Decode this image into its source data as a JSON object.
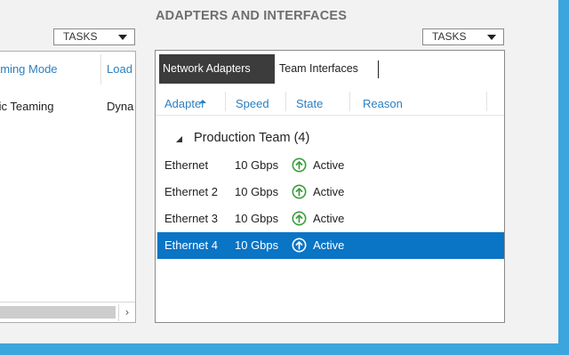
{
  "section": {
    "title": "ADAPTERS AND INTERFACES"
  },
  "left_tasks": {
    "label": "TASKS"
  },
  "right_tasks": {
    "label": "TASKS"
  },
  "left_panel": {
    "columns": [
      "aming Mode",
      "Load"
    ],
    "row": [
      "tic Teaming",
      "Dyna"
    ],
    "scroll_arrow": "›"
  },
  "tabs": [
    {
      "label": "Network Adapters",
      "active": true
    },
    {
      "label": "Team Interfaces",
      "active": false
    }
  ],
  "columns": [
    "Adapter",
    "Speed",
    "State",
    "Reason"
  ],
  "group": {
    "label": "Production Team (4)"
  },
  "adapters": [
    {
      "name": "Ethernet",
      "speed": "10 Gbps",
      "state": "Active",
      "selected": false
    },
    {
      "name": "Ethernet 2",
      "speed": "10 Gbps",
      "state": "Active",
      "selected": false
    },
    {
      "name": "Ethernet 3",
      "speed": "10 Gbps",
      "state": "Active",
      "selected": false
    },
    {
      "name": "Ethernet 4",
      "speed": "10 Gbps",
      "state": "Active",
      "selected": true
    }
  ],
  "icons": {
    "status": "arrow-up-circle-icon"
  },
  "colors": {
    "accent": "#2a7fc2",
    "selection": "#0a74c5",
    "status_ok": "#3a9d3a",
    "frame": "#3aa6dd"
  }
}
